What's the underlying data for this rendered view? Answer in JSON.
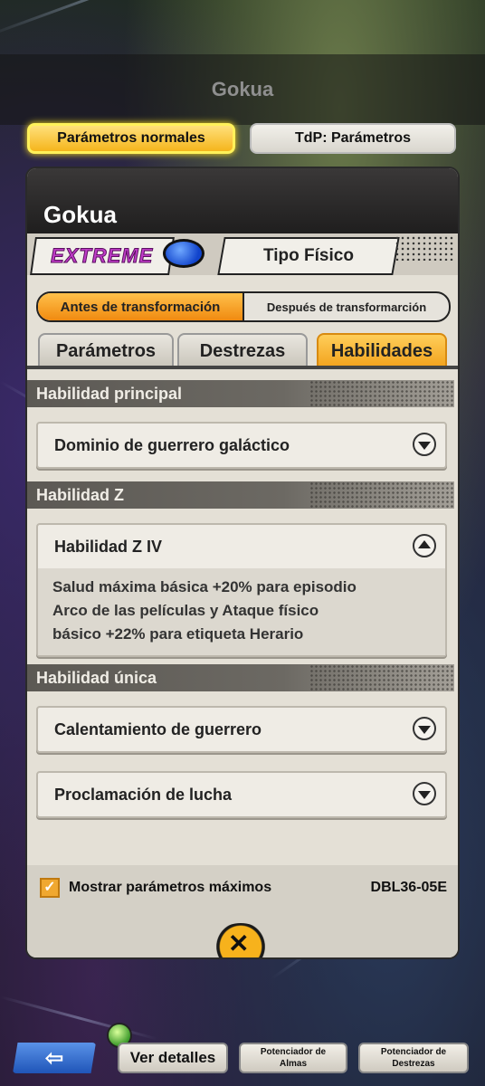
{
  "header": {
    "title": "Gokua"
  },
  "top_buttons": {
    "normal": "Parámetros normales",
    "tdp": "TdP: Parámetros"
  },
  "character": {
    "name": "Gokua",
    "rarity": "EXTREME",
    "type": "Tipo Físico",
    "type_color": "#1e5ee0"
  },
  "form_toggle": {
    "before": "Antes de transformación",
    "after": "Después de transformarción"
  },
  "tabs": [
    {
      "label": "Parámetros",
      "active": false
    },
    {
      "label": "Destrezas",
      "active": false
    },
    {
      "label": "Habilidades",
      "active": true
    }
  ],
  "sections": {
    "main": {
      "header": "Habilidad principal",
      "items": [
        {
          "title": "Dominio de guerrero galáctico",
          "expanded": false
        }
      ]
    },
    "z": {
      "header": "Habilidad Z",
      "items": [
        {
          "title": "Habilidad Z IV",
          "expanded": true,
          "lines": [
            "Salud máxima básica +20% para episodio",
            "Arco de las películas y Ataque físico",
            "básico +22% para etiqueta Herario"
          ]
        }
      ]
    },
    "unique": {
      "header": "Habilidad única",
      "items": [
        {
          "title": "Calentamiento de guerrero",
          "expanded": false
        },
        {
          "title": "Proclamación de lucha",
          "expanded": false
        }
      ]
    }
  },
  "footer": {
    "show_max_label": "Mostrar parámetros máximos",
    "show_max_checked": true,
    "code": "DBL36-05E"
  },
  "bottom_bar": {
    "back_icon": "arrow-left-icon",
    "details": "Ver detalles",
    "souls_line1": "Potenciador de",
    "souls_line2": "Almas",
    "skills_line1": "Potenciador de",
    "skills_line2": "Destrezas"
  },
  "colors": {
    "accent": "#f5b51c",
    "panel": "#e4e0d6",
    "rarity": "#c03cc8"
  }
}
